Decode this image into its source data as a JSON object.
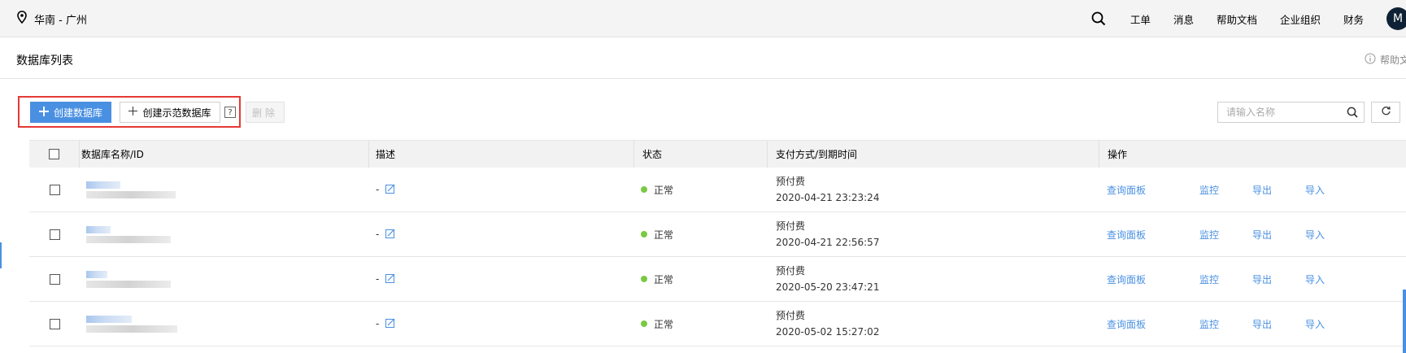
{
  "header": {
    "region": "华南 - 广州",
    "nav": [
      "工单",
      "消息",
      "帮助文档",
      "企业组织",
      "财务"
    ],
    "avatar_letter": "M"
  },
  "page": {
    "title": "数据库列表",
    "help_link": "帮助文"
  },
  "toolbar": {
    "create_db_label": "创建数据库",
    "create_demo_label": "创建示范数据库",
    "help_mark": "?",
    "delete_label": "删除",
    "search_placeholder": "请输入名称"
  },
  "table": {
    "columns": [
      "数据库名称/ID",
      "描述",
      "状态",
      "支付方式/到期时间",
      "操作"
    ],
    "rows": [
      {
        "desc": "-",
        "status": "正常",
        "pay_type": "预付费",
        "expire": "2020-04-21 23:23:24"
      },
      {
        "desc": "-",
        "status": "正常",
        "pay_type": "预付费",
        "expire": "2020-04-21 22:56:57"
      },
      {
        "desc": "-",
        "status": "正常",
        "pay_type": "预付费",
        "expire": "2020-05-20 23:47:21"
      },
      {
        "desc": "-",
        "status": "正常",
        "pay_type": "预付费",
        "expire": "2020-05-02 15:27:02"
      }
    ],
    "actions": [
      "查询面板",
      "监控",
      "导出",
      "导入"
    ]
  },
  "colors": {
    "primary": "#4a90e2",
    "status_ok": "#7ac943",
    "highlight": "#e53935"
  },
  "icons": [
    "location-pin-icon",
    "search-icon",
    "info-icon",
    "plus-icon",
    "refresh-icon",
    "edit-icon"
  ]
}
